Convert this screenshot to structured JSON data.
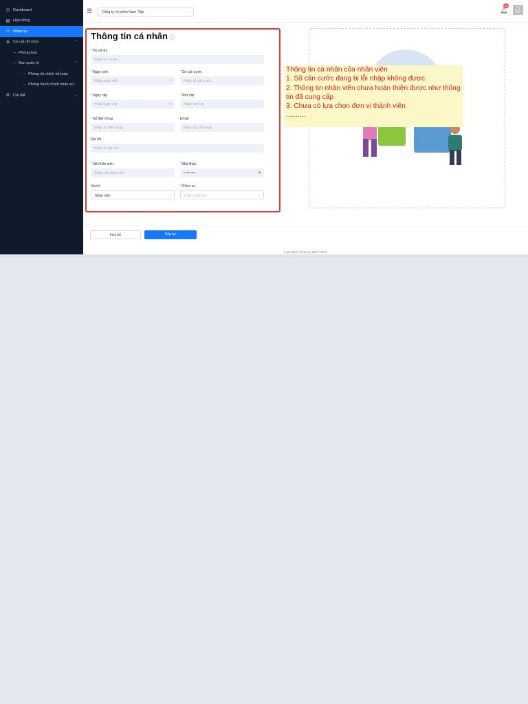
{
  "sidebar": {
    "items": [
      {
        "label": "Dashboard",
        "icon": "clock-icon",
        "level": 0,
        "active": false
      },
      {
        "label": "Hợp đồng",
        "icon": "document-icon",
        "level": 0,
        "active": false
      },
      {
        "label": "Nhân sự",
        "icon": "user-icon",
        "level": 0,
        "active": true
      },
      {
        "label": "Cơ cấu tổ chức",
        "icon": "org-icon",
        "level": 0,
        "active": false,
        "expanded": true
      },
      {
        "label": "Phòng ban",
        "level": 1
      },
      {
        "label": "Ban quản trị",
        "level": 1,
        "expanded": true
      },
      {
        "label": "Phòng tài chính kế toán",
        "level": 2
      },
      {
        "label": "Phòng hành chính nhân sự",
        "level": 2
      },
      {
        "label": "Cài đặt",
        "icon": "gear-icon",
        "level": 0,
        "active": false
      }
    ]
  },
  "header": {
    "company": "Công ty cổ phần Nam Tiệp",
    "notif_count": "99"
  },
  "form": {
    "title": "Thông tin cá nhân",
    "fields": {
      "ho_ten": {
        "label": "Họ và tên",
        "placeholder": "Nhập họ và tên",
        "required": true
      },
      "ngay_sinh": {
        "label": "Ngày sinh",
        "placeholder": "Nhập ngày sinh",
        "required": true
      },
      "so_can_cuoc": {
        "label": "Số căn cước",
        "placeholder": "Nhập số căn cước",
        "required": true
      },
      "ngay_cap": {
        "label": "Ngày cấp",
        "placeholder": "Nhập ngày cấp",
        "required": true
      },
      "noi_cap": {
        "label": "Nơi cấp",
        "placeholder": "Nhập nơi cấp",
        "required": true
      },
      "so_dien_thoai": {
        "label": "Số điện thoại",
        "placeholder": "Nhập số điện thoại",
        "required": true
      },
      "email": {
        "label": "Email",
        "placeholder": "Nhập địa chỉ email",
        "required": false
      },
      "dia_chi": {
        "label": "Địa chỉ",
        "placeholder": "Nhập số địa chỉ",
        "required": false
      },
      "ma_nhan_vien": {
        "label": "Mã nhân viên",
        "placeholder": "Nhập mã nhân viên",
        "required": true
      },
      "mat_khau": {
        "label": "Mật khẩu",
        "value": "••••••••",
        "required": true
      },
      "vai_tro": {
        "label": "Vai trò",
        "value": "Nhân viên",
        "required": false
      },
      "chuc_vu": {
        "label": "Chức vụ",
        "placeholder": "Chọn chức vụ",
        "required": true
      }
    },
    "cancel": "Huỷ bỏ",
    "next": "Tiếp tục"
  },
  "annotation": "Thông tin cá nhân của nhân viên\n1. Số căn cước đang bị lỗi nhập không được\n2. Thông tin nhân viên chưa hoàn thiện được như thông tin đã cung cấp\n3. Chưa có lựa chọn đơn vị thành viên\n..........",
  "footer": "Copyright ©2024 by INSYTECH"
}
